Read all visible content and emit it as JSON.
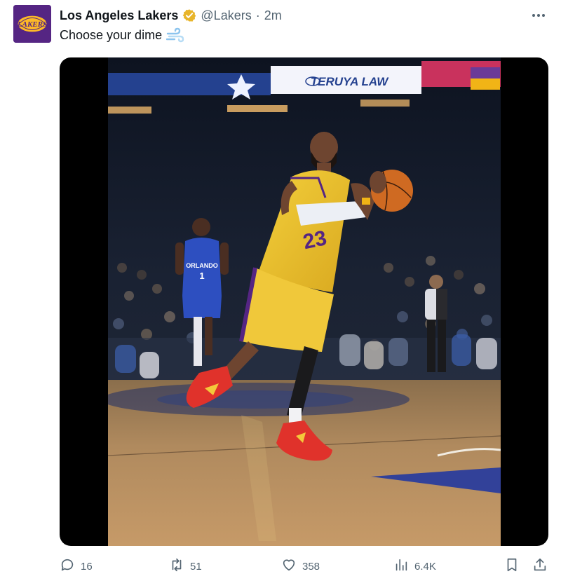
{
  "tweet": {
    "display_name": "Los Angeles Lakers",
    "handle": "@Lakers",
    "separator": "·",
    "time": "2m",
    "text": "Choose your dime",
    "avatar_text": "LAKERS",
    "media": {
      "banner_text": "TERUYA LAW",
      "player_number": "23",
      "opponent_text": "ORLANDO",
      "opponent_number": "1"
    },
    "stats": {
      "replies": "16",
      "reposts": "51",
      "likes": "358",
      "views": "6.4K"
    }
  },
  "colors": {
    "lakers_purple": "#552583",
    "lakers_gold": "#FDB927",
    "verified_badge": "#E8B52A",
    "secondary_text": "#536471"
  },
  "icons": [
    "verified-badge-icon",
    "dash-emoji-icon",
    "more-icon",
    "reply-icon",
    "repost-icon",
    "like-icon",
    "views-icon",
    "bookmark-icon",
    "share-icon"
  ]
}
